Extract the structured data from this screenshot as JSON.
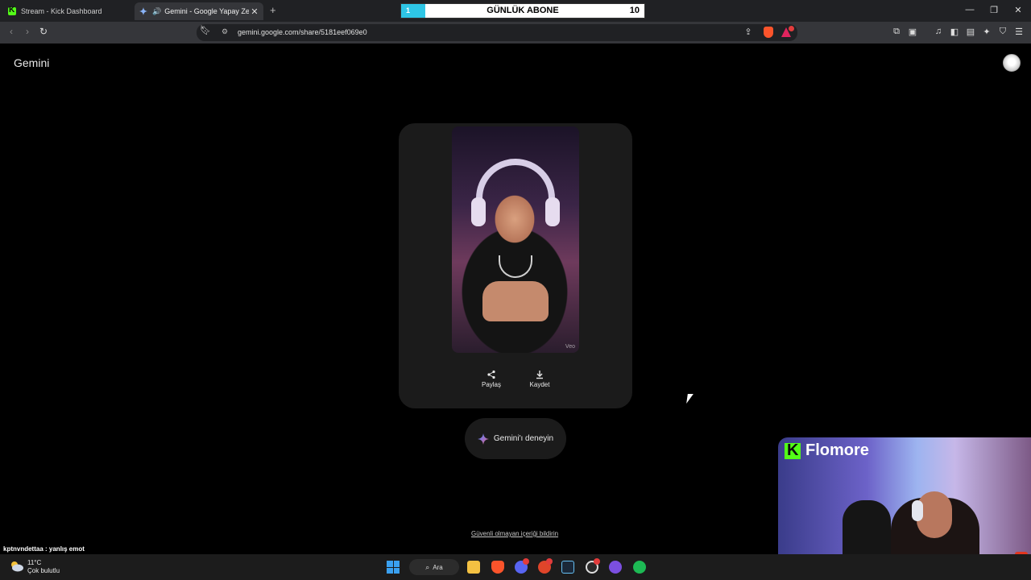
{
  "browser": {
    "tabs": [
      {
        "label": "Stream - Kick Dashboard",
        "active": false,
        "favicon": "kick-logo"
      },
      {
        "label": "Gemini - Google Yapay Zeka'y",
        "active": true,
        "favicon": "gemini-logo",
        "audio": true
      }
    ],
    "new_tab_glyph": "+",
    "url": "gemini.google.com/share/5181eef069e0"
  },
  "overlay_goal": {
    "title": "GÜNLÜK ABONE",
    "current": "1",
    "goal": "10",
    "progress": 0.1,
    "bar_color": "#2ec6e6"
  },
  "page": {
    "brand": "Gemini",
    "video_watermark": "Veo",
    "actions": [
      {
        "label": "Paylaş",
        "icon": "share-icon"
      },
      {
        "label": "Kaydet",
        "icon": "download-icon"
      }
    ],
    "try_button": "Gemini'ı deneyin",
    "report_link": "Güvenli olmayan içeriği bildirin"
  },
  "stream_overlay": {
    "chat_user": "kptnvndettaa",
    "chat_message": "yanlış emot",
    "cam_name": "Flomore",
    "kick_color": "#53fc18"
  },
  "taskbar": {
    "weather_temp": "11°C",
    "weather_desc": "Çok bulutlu",
    "search_label": "Ara"
  }
}
